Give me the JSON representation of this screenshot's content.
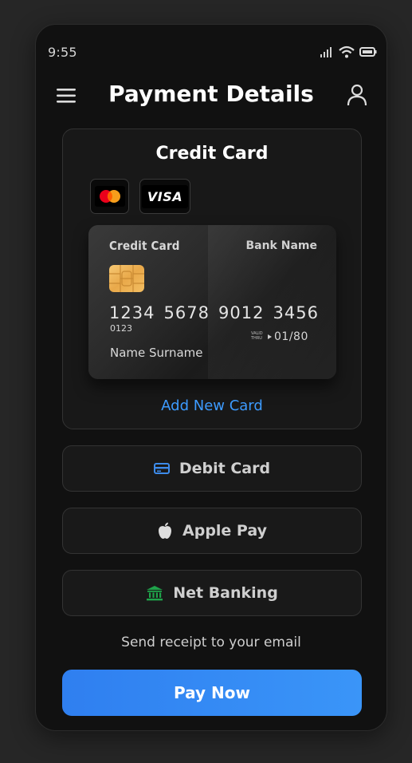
{
  "status": {
    "time": "9:55"
  },
  "header": {
    "title": "Payment Details"
  },
  "credit": {
    "title": "Credit Card",
    "brands": [
      "mastercard",
      "VISA"
    ],
    "card": {
      "label": "Credit Card",
      "bank": "Bank Name",
      "number": [
        "1234",
        "5678",
        "9012",
        "3456"
      ],
      "small_number": "0123",
      "valid_label": "VALID THRU",
      "expiry": "01/80",
      "holder": "Name Surname"
    },
    "add_card": "Add New Card"
  },
  "options": [
    {
      "label": "Debit Card",
      "icon": "credit-card-icon",
      "color": "#3d8bea"
    },
    {
      "label": "Apple Pay",
      "icon": "apple-icon",
      "color": "#dddddd"
    },
    {
      "label": "Net Banking",
      "icon": "bank-icon",
      "color": "#1fa34a"
    }
  ],
  "receipt_text": "Send receipt to your email",
  "pay_button": "Pay Now",
  "colors": {
    "accent": "#3d9bff",
    "button": "#3a8ef5",
    "bank": "#1fa34a",
    "background": "#111111"
  }
}
